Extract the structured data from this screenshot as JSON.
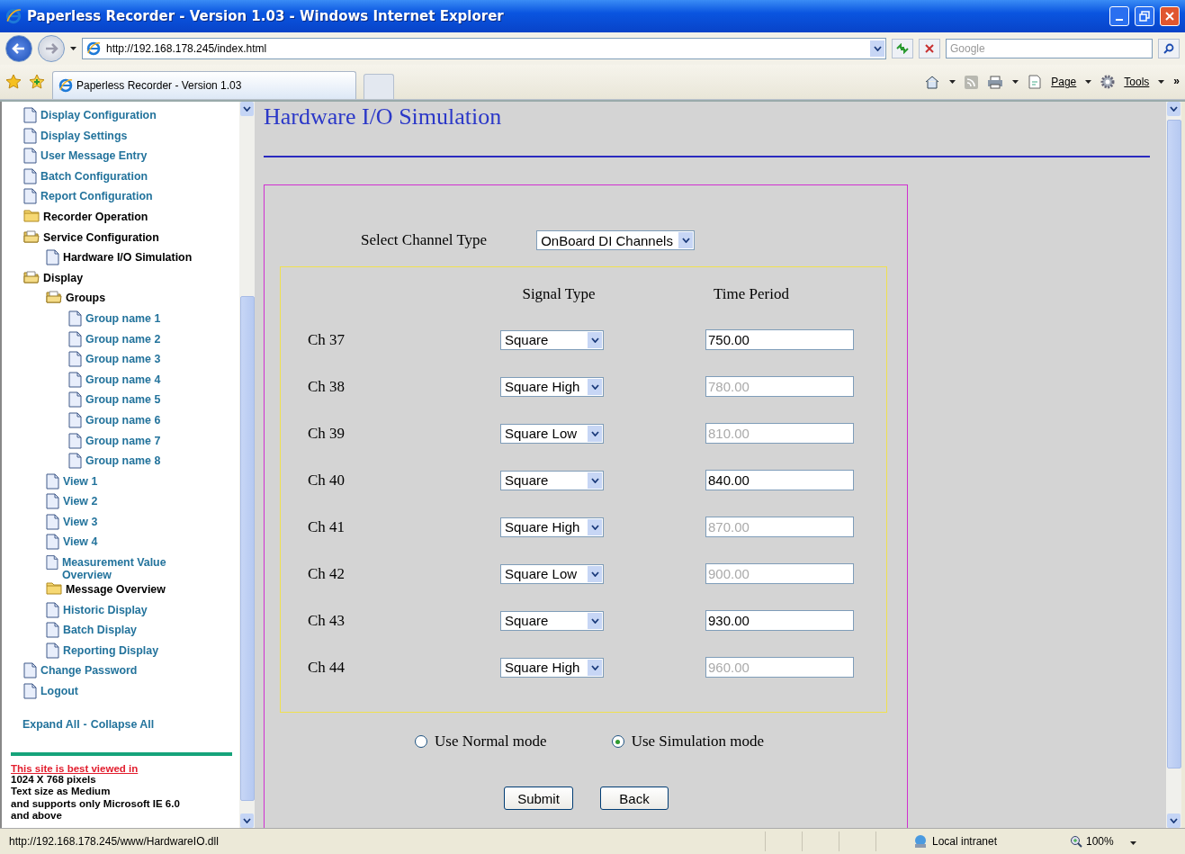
{
  "window": {
    "title": "Paperless Recorder - Version 1.03 - Windows Internet Explorer"
  },
  "browser": {
    "address": "http://192.168.178.245/index.html",
    "search_placeholder": "Google",
    "tab_title": "Paperless Recorder - Version 1.03",
    "commands": [
      {
        "kind": "page",
        "label": "Page"
      },
      {
        "kind": "tools",
        "label": "Tools"
      }
    ],
    "overflow": "»"
  },
  "sidebar": {
    "tree": [
      {
        "kind": "page",
        "label": "Display Configuration",
        "selected": false
      },
      {
        "kind": "page",
        "label": "Display Settings",
        "selected": false
      },
      {
        "kind": "page",
        "label": "User Message Entry",
        "selected": false
      },
      {
        "kind": "page",
        "label": "Batch Configuration",
        "selected": false
      },
      {
        "kind": "page",
        "label": "Report Configuration",
        "selected": false
      },
      {
        "kind": "folder",
        "label": "Recorder Operation",
        "expanded": false
      },
      {
        "kind": "folder",
        "label": "Service Configuration",
        "expanded": true,
        "children": [
          {
            "kind": "page",
            "label": "Hardware I/O Simulation",
            "selected": true
          }
        ]
      },
      {
        "kind": "folder",
        "label": "Display",
        "expanded": true,
        "children": [
          {
            "kind": "folder",
            "label": "Groups",
            "expanded": true,
            "children": [
              {
                "kind": "page",
                "label": "Group name 1",
                "selected": false
              },
              {
                "kind": "page",
                "label": "Group name 2",
                "selected": false
              },
              {
                "kind": "page",
                "label": "Group name 3",
                "selected": false
              },
              {
                "kind": "page",
                "label": "Group name 4",
                "selected": false
              },
              {
                "kind": "page",
                "label": "Group name 5",
                "selected": false
              },
              {
                "kind": "page",
                "label": "Group name 6",
                "selected": false
              },
              {
                "kind": "page",
                "label": "Group name 7",
                "selected": false
              },
              {
                "kind": "page",
                "label": "Group name 8",
                "selected": false
              }
            ]
          },
          {
            "kind": "page",
            "label": "View 1",
            "selected": false
          },
          {
            "kind": "page",
            "label": "View 2",
            "selected": false
          },
          {
            "kind": "page",
            "label": "View 3",
            "selected": false
          },
          {
            "kind": "page",
            "label": "View 4",
            "selected": false
          },
          {
            "kind": "page",
            "label": "Measurement Value Overview",
            "selected": false
          },
          {
            "kind": "folder",
            "label": "Message Overview",
            "expanded": false
          },
          {
            "kind": "page",
            "label": "Historic Display",
            "selected": false
          },
          {
            "kind": "page",
            "label": "Batch Display",
            "selected": false
          },
          {
            "kind": "page",
            "label": "Reporting Display",
            "selected": false
          }
        ]
      },
      {
        "kind": "page",
        "label": "Change Password",
        "selected": false
      },
      {
        "kind": "page",
        "label": "Logout",
        "selected": false
      }
    ],
    "expand_all": "Expand All",
    "separator": "-",
    "collapse_all": "Collapse All",
    "notice_link": "This site is best viewed in",
    "notice_lines": [
      "1024 X 768 pixels",
      "Text size as Medium",
      "and supports only Microsoft IE 6.0",
      "and above"
    ]
  },
  "main": {
    "heading": "Hardware I/O Simulation",
    "channel_type_label": "Select Channel Type",
    "channel_type": "OnBoard DI Channels",
    "columns": [
      "Signal Type",
      "Time Period"
    ],
    "channels": [
      {
        "name": "Ch 37",
        "signal_type": "Square",
        "time_period": "750.00",
        "disabled": false
      },
      {
        "name": "Ch 38",
        "signal_type": "Square High",
        "time_period": "780.00",
        "disabled": true
      },
      {
        "name": "Ch 39",
        "signal_type": "Square Low",
        "time_period": "810.00",
        "disabled": true
      },
      {
        "name": "Ch 40",
        "signal_type": "Square",
        "time_period": "840.00",
        "disabled": false
      },
      {
        "name": "Ch 41",
        "signal_type": "Square High",
        "time_period": "870.00",
        "disabled": true
      },
      {
        "name": "Ch 42",
        "signal_type": "Square Low",
        "time_period": "900.00",
        "disabled": true
      },
      {
        "name": "Ch 43",
        "signal_type": "Square",
        "time_period": "930.00",
        "disabled": false
      },
      {
        "name": "Ch 44",
        "signal_type": "Square High",
        "time_period": "960.00",
        "disabled": true
      }
    ],
    "modes": [
      {
        "label": "Use Normal mode",
        "selected": false
      },
      {
        "label": "Use Simulation mode",
        "selected": true
      }
    ],
    "buttons": [
      "Submit",
      "Back"
    ]
  },
  "status_bar": {
    "url": "http://192.168.178.245/www/HardwareIO.dll",
    "zone": "Local intranet",
    "zoom": "100%"
  }
}
